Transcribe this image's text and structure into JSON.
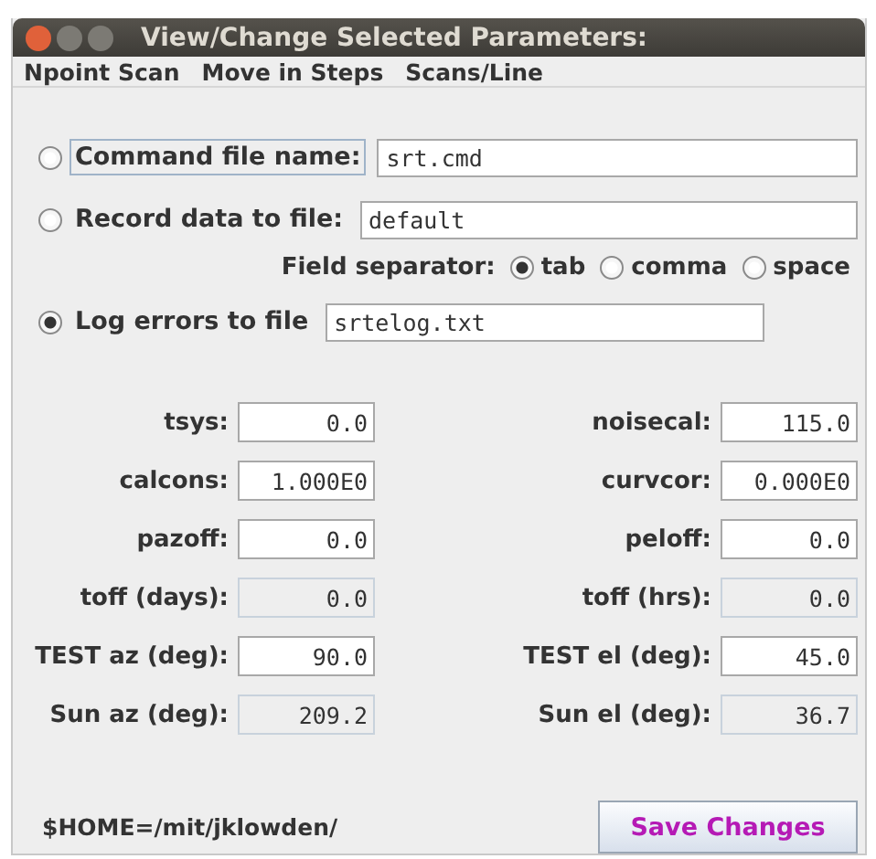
{
  "window": {
    "title": "View/Change Selected Parameters:"
  },
  "menu": [
    "Npoint Scan",
    "Move in Steps",
    "Scans/Line"
  ],
  "file_options": [
    {
      "label": "Command file name:",
      "selected": false,
      "focused": true,
      "value": "srt.cmd"
    },
    {
      "label": "Record data to file:",
      "selected": false,
      "focused": false,
      "value": "default"
    },
    {
      "label": "Log errors to file",
      "selected": true,
      "focused": false,
      "value": "srtelog.txt"
    }
  ],
  "field_separator": {
    "label": "Field separator:",
    "options": [
      {
        "label": "tab",
        "selected": true
      },
      {
        "label": "comma",
        "selected": false
      },
      {
        "label": "space",
        "selected": false
      }
    ]
  },
  "parameters": [
    {
      "label": "tsys:",
      "value": "0.0",
      "disabled": false
    },
    {
      "label": "noisecal:",
      "value": "115.0",
      "disabled": false
    },
    {
      "label": "calcons:",
      "value": "1.000E0",
      "disabled": false
    },
    {
      "label": "curvcor:",
      "value": "0.000E0",
      "disabled": false
    },
    {
      "label": "pazoff:",
      "value": "0.0",
      "disabled": false
    },
    {
      "label": "peloff:",
      "value": "0.0",
      "disabled": false
    },
    {
      "label": "toff (days):",
      "value": "0.0",
      "disabled": true
    },
    {
      "label": "toff (hrs):",
      "value": "0.0",
      "disabled": true
    },
    {
      "label": "TEST az (deg):",
      "value": "90.0",
      "disabled": false
    },
    {
      "label": "TEST el (deg):",
      "value": "45.0",
      "disabled": false
    },
    {
      "label": "Sun az (deg):",
      "value": "209.2",
      "disabled": true
    },
    {
      "label": "Sun el (deg):",
      "value": "36.7",
      "disabled": true
    }
  ],
  "home_path": "$HOME=/mit/jklowden/",
  "save_button": "Save Changes"
}
